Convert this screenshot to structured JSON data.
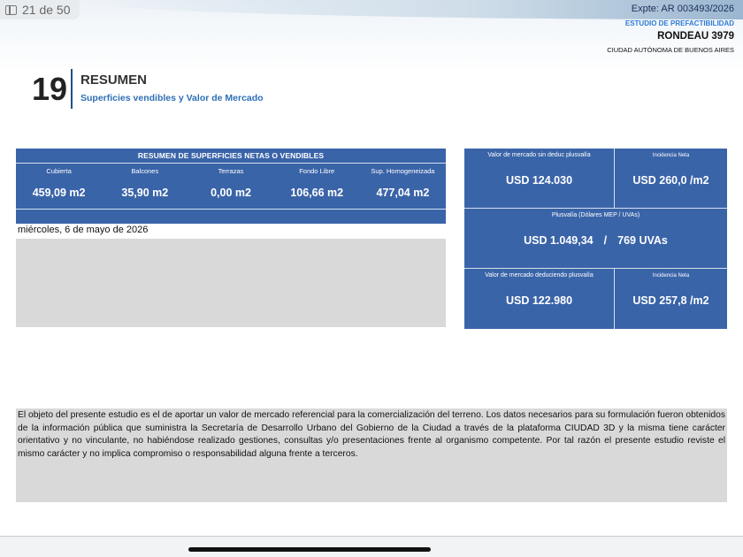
{
  "viewer": {
    "page_indicator": "21 de 50",
    "sidebar_icon": "sidebar-toggle-icon"
  },
  "header": {
    "expte": "Expte: AR 003493/2026",
    "study_type": "ESTUDIO DE PREFACTIBILIDAD",
    "address": "RONDEAU 3979",
    "city": "CIUDAD AUTÓNOMA DE BUENOS AIRES"
  },
  "section": {
    "number": "19",
    "title": "RESUMEN",
    "subtitle": "Superficies vendibles y Valor de Mercado"
  },
  "surfaces": {
    "title": "RESUMEN DE SUPERFICIES NETAS O VENDIBLES",
    "columns": [
      {
        "label": "Cubierta",
        "value": "459,09 m2"
      },
      {
        "label": "Balcones",
        "value": "35,90 m2"
      },
      {
        "label": "Terrazas",
        "value": "0,00 m2"
      },
      {
        "label": "Fondo Libre",
        "value": "106,66 m2"
      },
      {
        "label": "Sup. Homogeneizada",
        "value": "477,04 m2"
      }
    ]
  },
  "date": "miércoles, 6 de mayo de 2026",
  "valuation": {
    "market_no_deduction": {
      "label": "Valor de mercado sin deduc plusvalía",
      "value": "USD  124.030"
    },
    "net_incidence_1": {
      "label": "Incidencia Neta",
      "value": "USD  260,0 /m2"
    },
    "plusvalia": {
      "label": "Plusvalía (Dólares MEP / UVAs)",
      "usd": "USD  1.049,34",
      "separator": "/",
      "uvas": "769 UVAs"
    },
    "market_deducted": {
      "label": "Valor de mercado deduciendo plusvalía",
      "value": "USD  122.980"
    },
    "net_incidence_2": {
      "label": "Incidencia Neta",
      "value": "USD  257,8 /m2"
    }
  },
  "disclaimer": "El objeto del presente estudio es el de aportar un valor de mercado referencial para la comercialización del terreno. Los datos necesarios para su formulación fueron obtenidos de la información pública que suministra la Secretaría de Desarrollo Urbano del Gobierno de la Ciudad a través de la plataforma CIUDAD 3D y la misma tiene carácter orientativo y no vinculante, no habiéndose realizado gestiones, consultas y/o presentaciones frente al organismo competente. Por tal razón el presente estudio reviste el mismo carácter y no implica compromiso o responsabilidad alguna frente a terceros.",
  "colors": {
    "panel_blue": "#3a64a8",
    "grey_block": "#d9d9d9",
    "accent_blue": "#2e6fb5"
  }
}
